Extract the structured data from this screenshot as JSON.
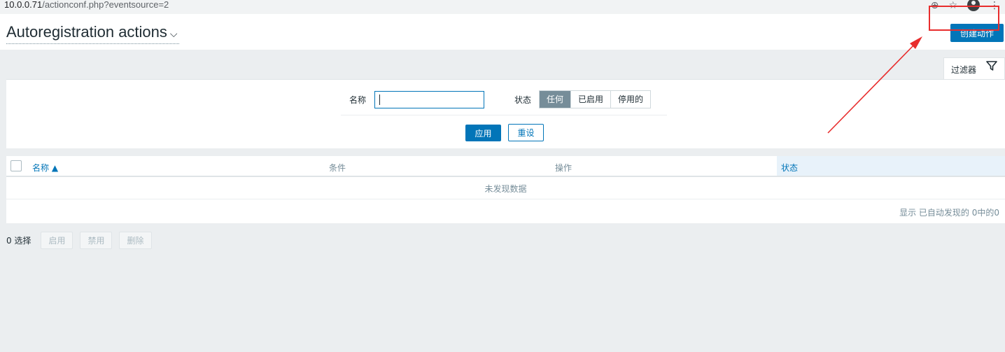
{
  "browser": {
    "url_host": "10.0.0.71",
    "url_rest": "/actionconf.php?eventsource=2",
    "icons": [
      "zoom-icon",
      "star-icon",
      "profile-icon",
      "menu-icon"
    ]
  },
  "header": {
    "title": "Autoregistration actions",
    "create_button": "创建动作"
  },
  "filter": {
    "tab_label": "过滤器",
    "name_label": "名称",
    "name_value": "",
    "status_label": "状态",
    "status_options": [
      "任何",
      "已启用",
      "停用的"
    ],
    "status_selected": "任何",
    "apply": "应用",
    "reset": "重设"
  },
  "table": {
    "columns": [
      "名称 ▲",
      "条件",
      "操作",
      "状态"
    ],
    "sorted_column": "名称",
    "empty_text": "未发现数据",
    "footer": "显示 已自动发现的 0中的0"
  },
  "bulk": {
    "selected": "0 选择",
    "enable": "启用",
    "disable": "禁用",
    "delete": "删除"
  },
  "colors": {
    "accent": "#0275b8",
    "annotation": "#e82d2d",
    "selected_segment": "#768d99"
  }
}
